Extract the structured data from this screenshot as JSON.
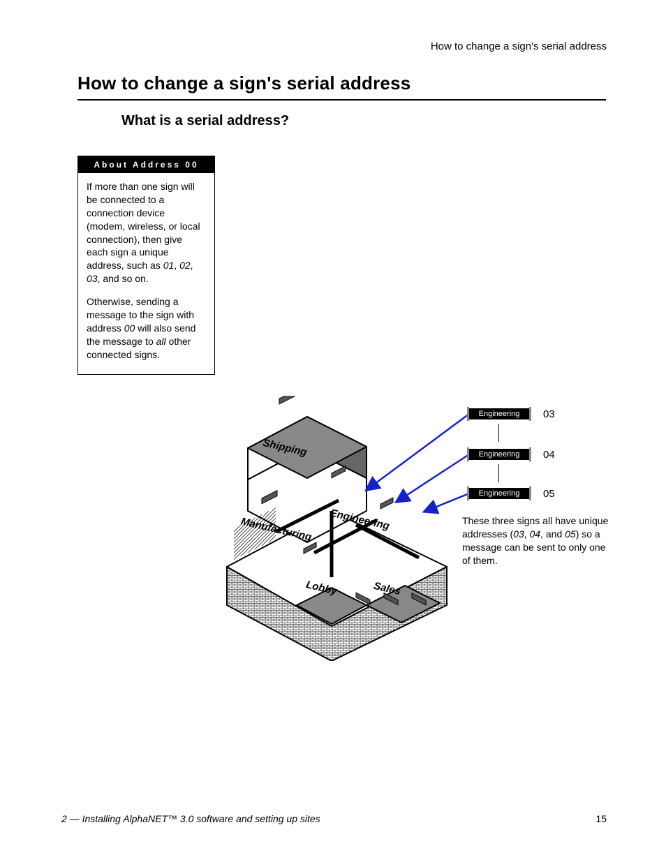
{
  "running_head": "How to change a sign's serial address",
  "title": "How to change a sign's serial address",
  "subtitle": "What is a serial address?",
  "sidebar": {
    "title": "About Address 00",
    "p1a": "If more than one sign will be connected to a connection device (modem, wireless, or local connection), then give each sign a unique address, such as ",
    "p1_01": "01",
    "p1_c1": ", ",
    "p1_02": "02",
    "p1_c2": ", ",
    "p1_03": "03",
    "p1_end": ", and so on.",
    "p2a": "Otherwise, sending a message to the sign with address ",
    "p2_00": "00",
    "p2b": " will also send the message to ",
    "p2_all": "all",
    "p2c": " other connected signs."
  },
  "signs": [
    {
      "label": "Engineering",
      "addr": "03"
    },
    {
      "label": "Engineering",
      "addr": "04"
    },
    {
      "label": "Engineering",
      "addr": "05"
    }
  ],
  "caption": {
    "a": "These three signs all have unique addresses (",
    "n1": "03",
    "c1": ", ",
    "n2": "04",
    "c2": ", and ",
    "n3": "05",
    "b": ") so a message can be sent to only one of them."
  },
  "rooms": {
    "shipping": "Shipping",
    "manufacturing": "Manufacturing",
    "engineering": "Engineering",
    "lobby": "Lobby",
    "sales": "Sales"
  },
  "footer": {
    "left": "2 — Installing AlphaNET™ 3.0 software and setting up sites",
    "right": "15"
  }
}
